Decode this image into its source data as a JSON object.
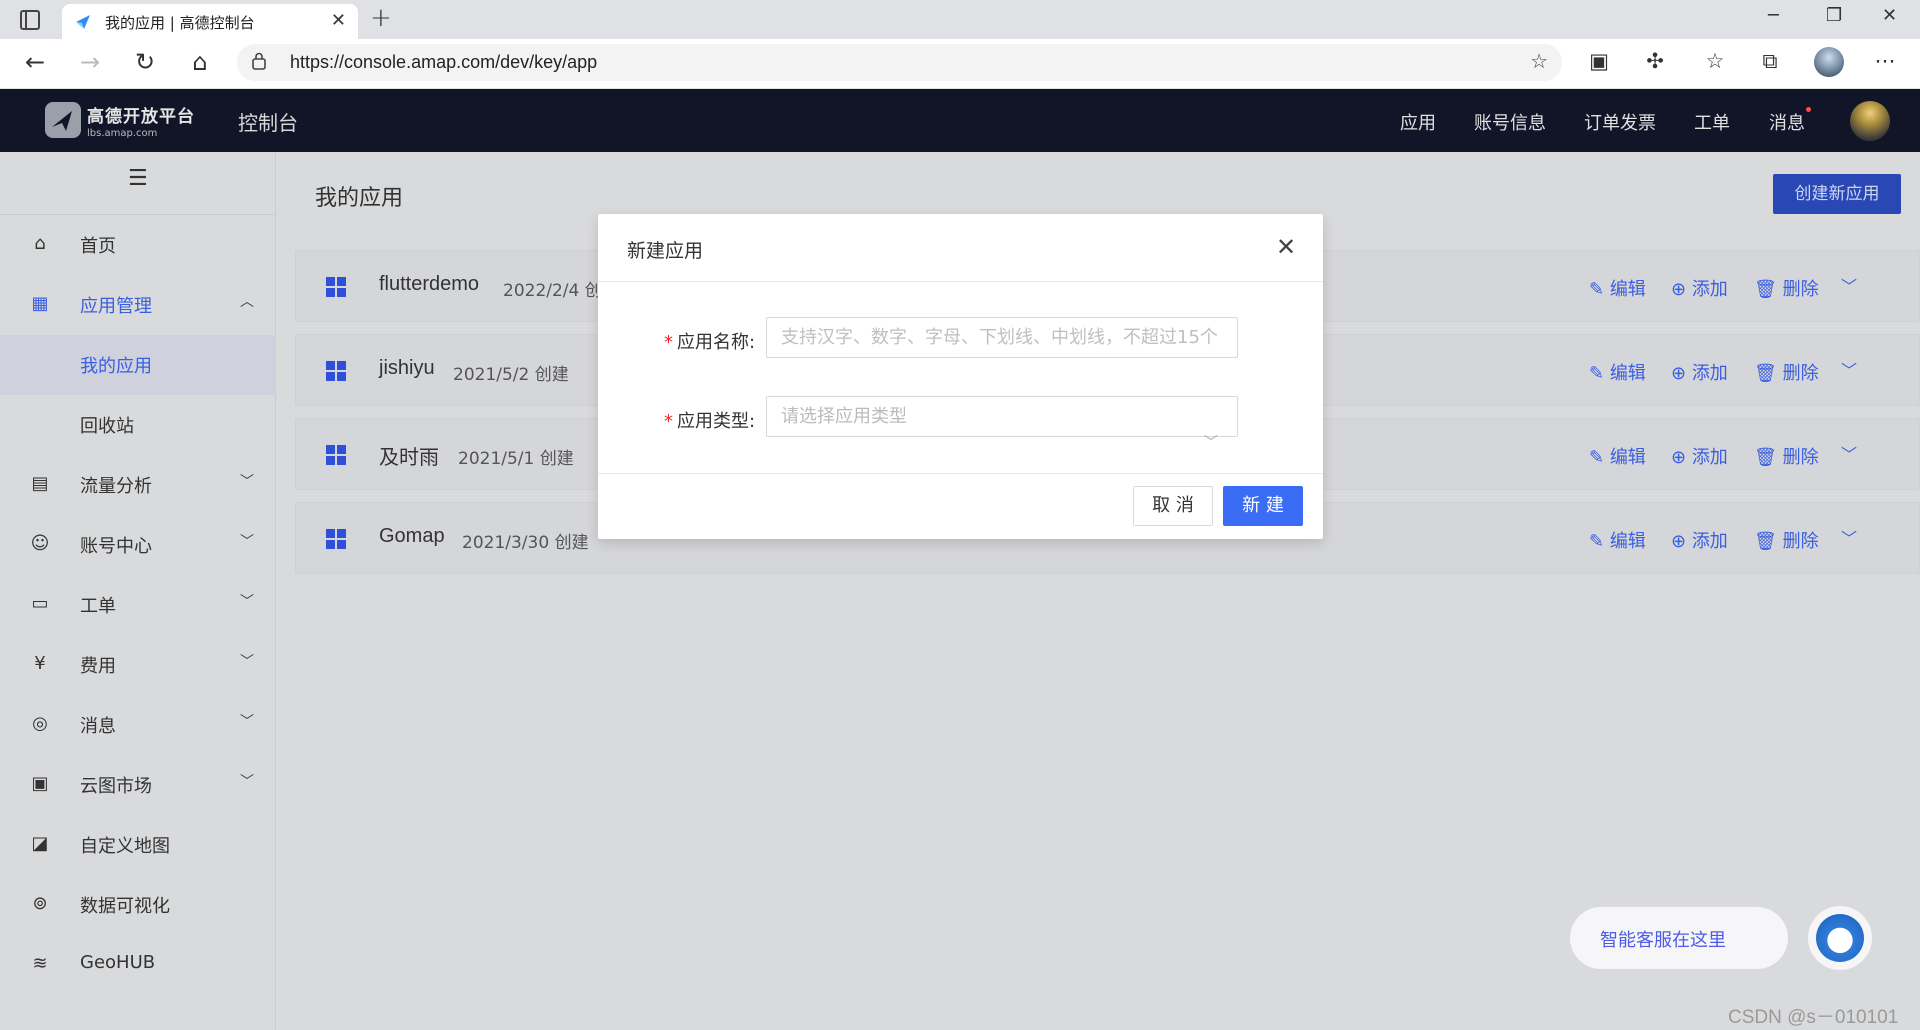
{
  "browser": {
    "tab_title": "我的应用 | 高德控制台",
    "url": "https://console.amap.com/dev/key/app"
  },
  "header": {
    "logo_line1": "高德开放平台",
    "logo_line2": "lbs.amap.com",
    "console_title": "控制台",
    "nav": [
      "应用",
      "账号信息",
      "订单发票",
      "工单",
      "消息"
    ]
  },
  "sidebar": {
    "items": [
      {
        "label": "首页",
        "icon": "home-icon"
      },
      {
        "label": "应用管理",
        "icon": "grid-icon"
      },
      {
        "label": "我的应用"
      },
      {
        "label": "回收站"
      },
      {
        "label": "流量分析",
        "icon": "chart-icon"
      },
      {
        "label": "账号中心",
        "icon": "user-icon"
      },
      {
        "label": "工单",
        "icon": "ticket-icon"
      },
      {
        "label": "费用",
        "icon": "fee-icon"
      },
      {
        "label": "消息",
        "icon": "message-icon"
      },
      {
        "label": "云图市场",
        "icon": "store-icon"
      },
      {
        "label": "自定义地图",
        "icon": "map-edit-icon"
      },
      {
        "label": "数据可视化",
        "icon": "visual-icon"
      },
      {
        "label": "GeoHUB",
        "icon": "layers-icon"
      }
    ]
  },
  "main": {
    "title": "我的应用",
    "create_label": "创建新应用",
    "apps": [
      {
        "name": "flutterdemo",
        "date": "2022/2/4 创建"
      },
      {
        "name": "jishiyu",
        "date": "2021/5/2 创建"
      },
      {
        "name": "及时雨",
        "date": "2021/5/1 创建"
      },
      {
        "name": "Gomap",
        "date": "2021/3/30 创建"
      }
    ],
    "actions": {
      "edit": "编辑",
      "add": "添加",
      "delete": "删除"
    }
  },
  "modal": {
    "title": "新建应用",
    "name_label": "应用名称:",
    "name_placeholder": "支持汉字、数字、字母、下划线、中划线，不超过15个",
    "type_label": "应用类型:",
    "type_placeholder": "请选择应用类型",
    "cancel_label": "取 消",
    "ok_label": "新 建"
  },
  "service": {
    "label": "智能客服在这里"
  },
  "watermark": "CSDN @s－010101",
  "colors": {
    "accent": "#3b6cf6",
    "header_bg": "#111527",
    "link": "#3a5ee0"
  }
}
